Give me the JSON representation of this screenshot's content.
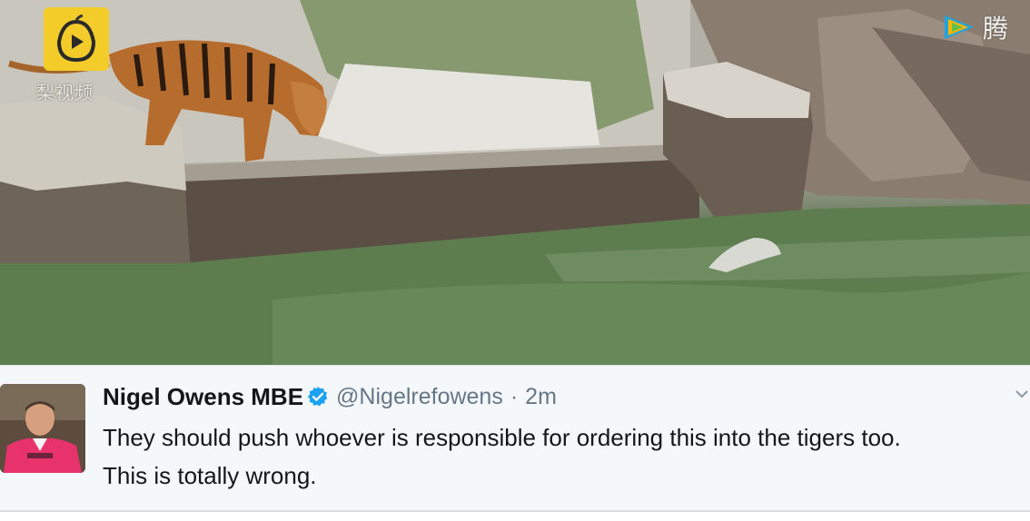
{
  "video": {
    "watermark_left_icon": "play-pear-icon",
    "watermark_left_text": "梨视频",
    "watermark_right_icon": "tencent-video-icon",
    "watermark_right_text": "腾"
  },
  "tweet": {
    "display_name": "Nigel Owens MBE",
    "verified_icon": "verified-badge-icon",
    "handle": "@Nigelrefowens",
    "separator": "·",
    "timestamp": "2m",
    "text_line_1": "They should push whoever is responsible for ordering this into the tigers too.",
    "text_line_2": "This is totally wrong.",
    "menu_icon": "chevron-down-icon"
  },
  "colors": {
    "verified": "#1da1f2",
    "name": "#14171a",
    "meta": "#657786",
    "logo_yellow": "#f4cc2a"
  }
}
